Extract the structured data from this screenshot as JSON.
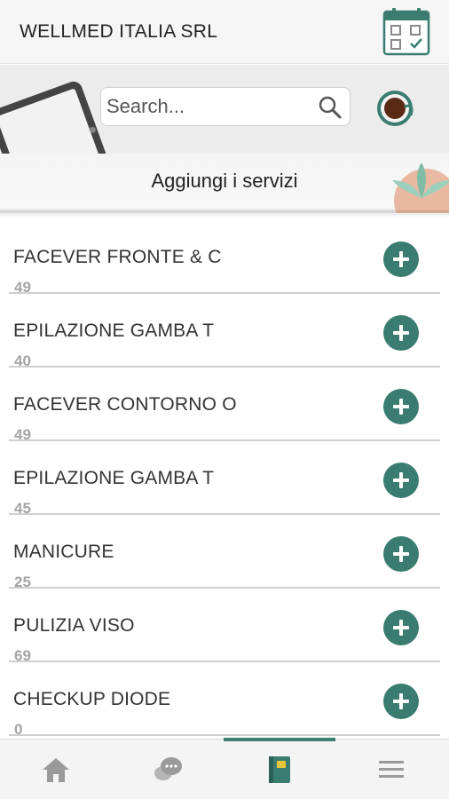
{
  "header": {
    "company": "WELLMED ITALIA SRL",
    "calendar_icon": "calendar-check-icon"
  },
  "banner": {
    "search_placeholder": "Search...",
    "subtitle": "Aggiungi i servizi",
    "avatar_icon": "user-avatar-icon"
  },
  "services": [
    {
      "name": "FACEVER FRONTE & C",
      "value": "49"
    },
    {
      "name": "EPILAZIONE GAMBA T",
      "value": "40"
    },
    {
      "name": "FACEVER CONTORNO O",
      "value": "49"
    },
    {
      "name": "EPILAZIONE GAMBA T",
      "value": "45"
    },
    {
      "name": "MANICURE",
      "value": "25"
    },
    {
      "name": "PULIZIA VISO",
      "value": "69"
    },
    {
      "name": "CHECKUP DIODE",
      "value": "0"
    }
  ],
  "tabs": [
    {
      "icon": "home-icon",
      "active": false
    },
    {
      "icon": "chat-icon",
      "active": false
    },
    {
      "icon": "book-icon",
      "active": true
    },
    {
      "icon": "menu-icon",
      "active": false
    }
  ],
  "colors": {
    "accent": "#3a7d70",
    "muted_number": "#a4a4a4",
    "background": "#ececec"
  }
}
